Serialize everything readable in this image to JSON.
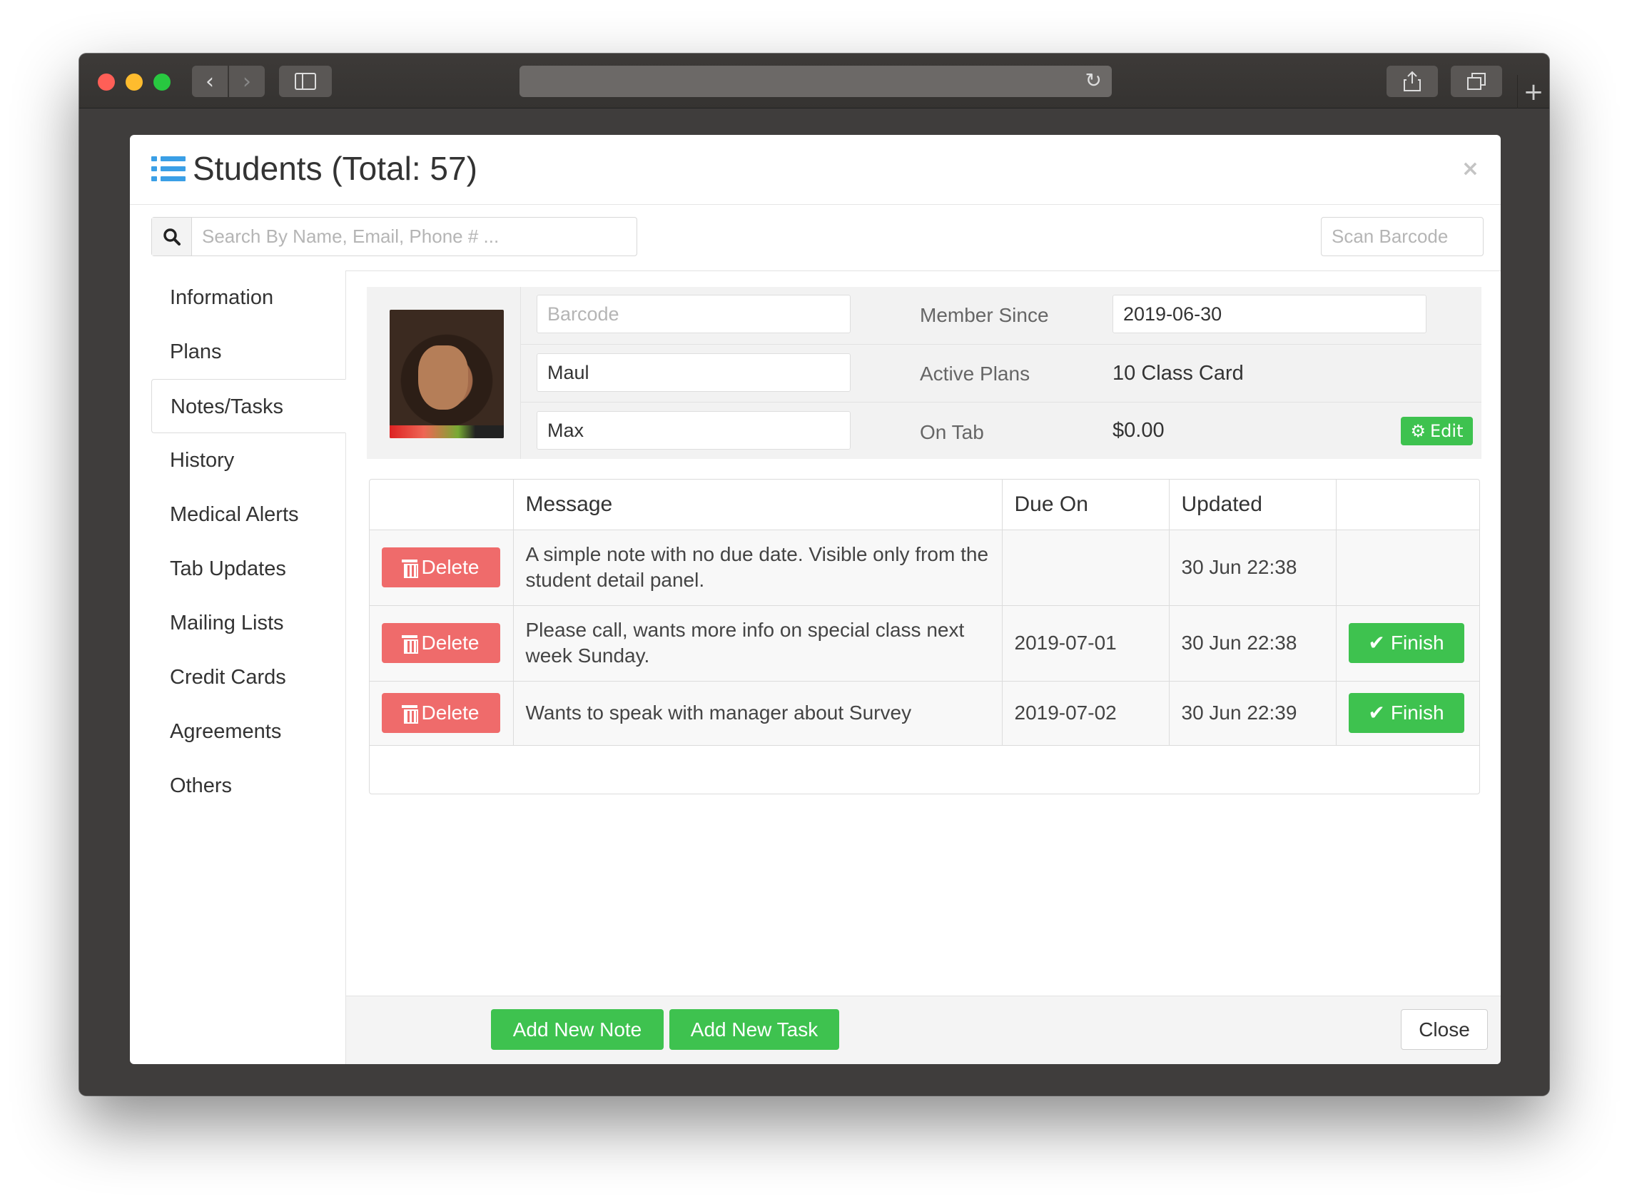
{
  "browser": {
    "back_icon": "chevron-left-icon",
    "forward_icon": "chevron-right-icon",
    "reload_icon": "reload-icon",
    "share_icon": "share-icon",
    "tabs_icon": "tabs-icon",
    "new_tab_icon": "plus-icon"
  },
  "modal": {
    "title": "Students (Total: 57)",
    "close_symbol": "×",
    "search_placeholder": "Search By Name, Email, Phone # ...",
    "scan_placeholder": "Scan Barcode"
  },
  "nav": {
    "items": [
      {
        "label": "Information",
        "active": false
      },
      {
        "label": "Plans",
        "active": false
      },
      {
        "label": "Notes/Tasks",
        "active": true
      },
      {
        "label": "History",
        "active": false
      },
      {
        "label": "Medical Alerts",
        "active": false
      },
      {
        "label": "Tab Updates",
        "active": false
      },
      {
        "label": "Mailing Lists",
        "active": false
      },
      {
        "label": "Credit Cards",
        "active": false
      },
      {
        "label": "Agreements",
        "active": false
      },
      {
        "label": "Others",
        "active": false
      }
    ]
  },
  "student": {
    "barcode_placeholder": "Barcode",
    "first_name": "Maul",
    "last_name": "Max",
    "member_since_label": "Member Since",
    "member_since_value": "2019-06-30",
    "active_plans_label": "Active Plans",
    "active_plans_value": "10 Class Card",
    "on_tab_label": "On Tab",
    "on_tab_value": "$0.00",
    "edit_label": "Edit"
  },
  "table": {
    "headers": [
      "",
      "Message",
      "Due On",
      "Updated",
      ""
    ],
    "delete_label": "Delete",
    "finish_label": "Finish",
    "rows": [
      {
        "message": "A simple note with no due date. Visible only from the student detail panel.",
        "due_on": "",
        "updated": "30 Jun 22:38",
        "finishable": false
      },
      {
        "message": "Please call, wants more info on special class next week Sunday.",
        "due_on": "2019-07-01",
        "updated": "30 Jun 22:38",
        "finishable": true
      },
      {
        "message": "Wants to speak with manager about Survey",
        "due_on": "2019-07-02",
        "updated": "30 Jun 22:39",
        "finishable": true
      }
    ]
  },
  "footer": {
    "add_note_label": "Add New Note",
    "add_task_label": "Add New Task",
    "close_label": "Close"
  },
  "colors": {
    "accent_blue": "#3a9fe6",
    "green": "#3ec24f",
    "red": "#ef6b6b"
  }
}
